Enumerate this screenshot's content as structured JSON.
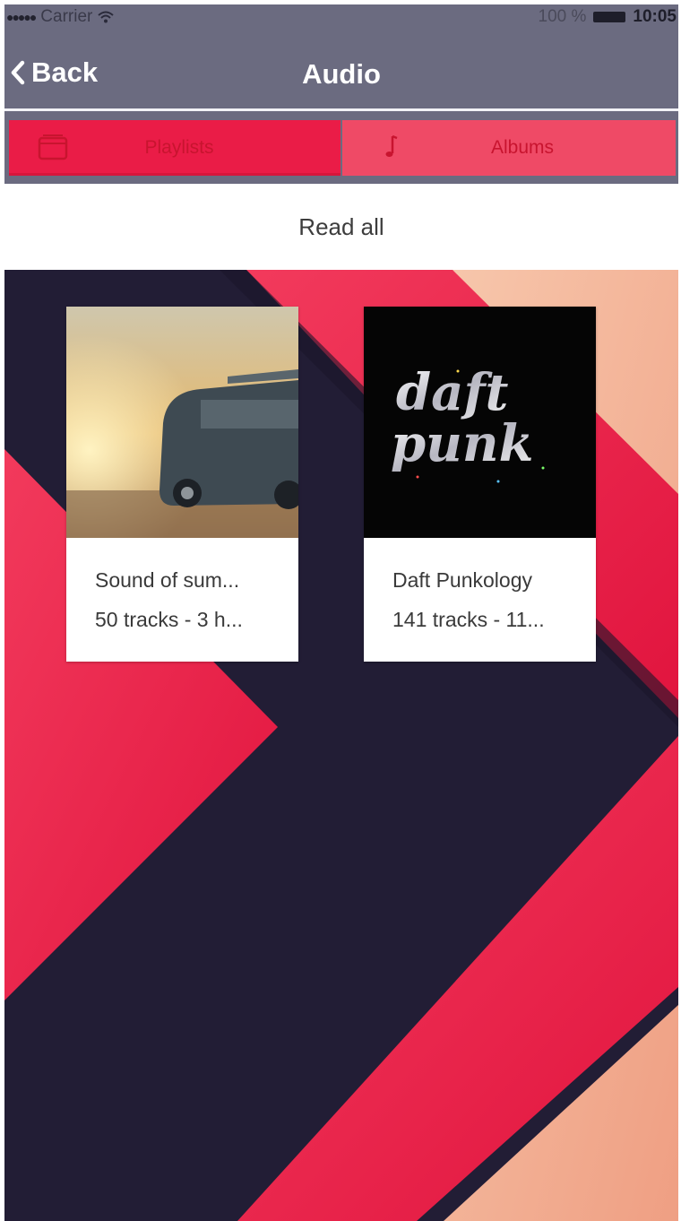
{
  "status_bar": {
    "carrier": "Carrier",
    "battery_percent": "100 %",
    "time": "10:05"
  },
  "nav_bar": {
    "back_label": "Back",
    "title": "Audio"
  },
  "tabs": [
    {
      "label": "Playlists",
      "icon": "playlist-folder-icon",
      "selected": true
    },
    {
      "label": "Albums",
      "icon": "music-note-icon",
      "selected": false
    }
  ],
  "read_all_label": "Read all",
  "playlists": [
    {
      "title": "Sound of sum...",
      "subtitle": "50 tracks - 3 h...",
      "cover": "van-sunset-cover"
    },
    {
      "title": "Daft Punkology",
      "subtitle": "141 tracks - 11...",
      "cover": "daft-punk-logo-cover",
      "cover_text": "daft punk"
    }
  ],
  "colors": {
    "header_bg": "#6b6b80",
    "accent_red": "#ea1c47",
    "accent_red_light": "#ef4a66",
    "background_dark": "#221d35",
    "background_peach": "#f3b79b"
  }
}
